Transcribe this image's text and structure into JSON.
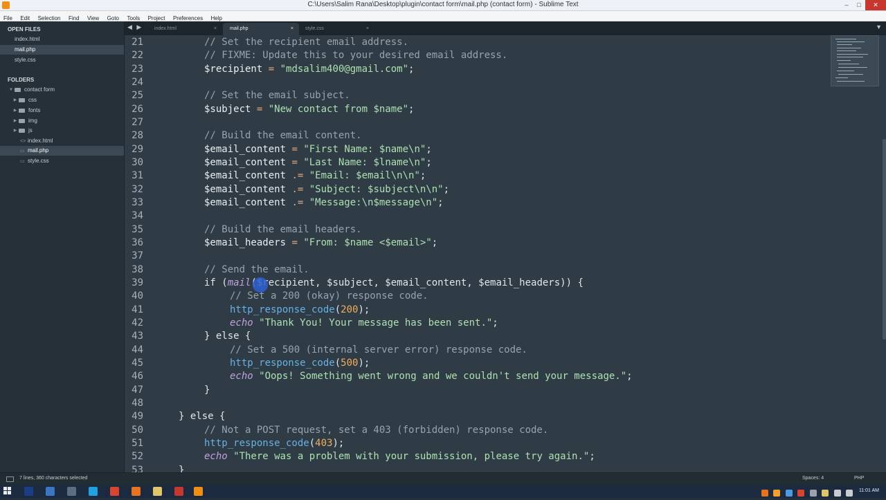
{
  "window": {
    "title": "C:\\Users\\Salim Rana\\Desktop\\plugin\\contact form\\mail.php (contact form) - Sublime Text",
    "controls": [
      "–",
      "□",
      "✕"
    ]
  },
  "menu": [
    "File",
    "Edit",
    "Selection",
    "Find",
    "View",
    "Goto",
    "Tools",
    "Project",
    "Preferences",
    "Help"
  ],
  "sidebar": {
    "open_files_header": "OPEN FILES",
    "open_files": [
      "index.html",
      "mail.php",
      "style.css"
    ],
    "folders_header": "FOLDERS",
    "root_folder": "contact form",
    "folders": [
      "css",
      "fonts",
      "img",
      "js"
    ],
    "files": [
      "index.html",
      "mail.php",
      "style.css"
    ]
  },
  "tabs": [
    {
      "label": "index.html",
      "close": "×"
    },
    {
      "label": "mail.php",
      "close": "×"
    },
    {
      "label": "style.css",
      "close": "×"
    }
  ],
  "tab_arrows": "◀ ▶",
  "tab_menu": "▼",
  "editor": {
    "line_numbers": [
      "21",
      "22",
      "23",
      "24",
      "25",
      "26",
      "27",
      "28",
      "29",
      "30",
      "31",
      "32",
      "33",
      "34",
      "35",
      "36",
      "37",
      "38",
      "39",
      "40",
      "41",
      "42",
      "43",
      "44",
      "45",
      "46",
      "47",
      "48",
      "49",
      "50",
      "51",
      "52",
      "53"
    ],
    "code": {
      "l21": "// Set the recipient email address.",
      "l22": "// FIXME: Update this to your desired email address.",
      "l23_var": "$recipient",
      "l23_op": " = ",
      "l23_str": "\"mdsalim400@gmail.com\"",
      "l23_end": ";",
      "l25": "// Set the email subject.",
      "l26_var": "$subject",
      "l26_op": " = ",
      "l26_str": "\"New contact from $name\"",
      "l26_end": ";",
      "l28": "// Build the email content.",
      "l29_var": "$email_content",
      "l29_op": " = ",
      "l29_str": "\"First Name: $name\\n\"",
      "l29_end": ";",
      "l30_var": "$email_content",
      "l30_op": " = ",
      "l30_str": "\"Last Name: $lname\\n\"",
      "l30_end": ";",
      "l31_var": "$email_content",
      "l31_op": " .= ",
      "l31_str": "\"Email: $email\\n\\n\"",
      "l31_end": ";",
      "l32_var": "$email_content",
      "l32_op": " .= ",
      "l32_str": "\"Subject: $subject\\n\\n\"",
      "l32_end": ";",
      "l33_var": "$email_content",
      "l33_op": " .= ",
      "l33_str": "\"Message:\\n$message\\n\"",
      "l33_end": ";",
      "l35": "// Build the email headers.",
      "l36_var": "$email_headers",
      "l36_op": " = ",
      "l36_str": "\"From: $name <$email>\"",
      "l36_end": ";",
      "l38": "// Send the email.",
      "l39_if": "if (",
      "l39_fn": "mail",
      "l39_rest": "($recipient, $subject, $email_content, $email_headers)) {",
      "l40": "// Set a 200 (okay) response code.",
      "l41_fn": "http_response_code",
      "l41_open": "(",
      "l41_num": "200",
      "l41_close": ");",
      "l42_kw": "echo",
      "l42_str": " \"Thank You! Your message has been sent.\"",
      "l42_end": ";",
      "l43": "} else {",
      "l44": "// Set a 500 (internal server error) response code.",
      "l45_fn": "http_response_code",
      "l45_open": "(",
      "l45_num": "500",
      "l45_close": ");",
      "l46_kw": "echo",
      "l46_str": " \"Oops! Something went wrong and we couldn't send your message.\"",
      "l46_end": ";",
      "l47": "}",
      "l49": "} else {",
      "l50": "// Not a POST request, set a 403 (forbidden) response code.",
      "l51_fn": "http_response_code",
      "l51_open": "(",
      "l51_num": "403",
      "l51_close": ");",
      "l52_kw": "echo",
      "l52_str": " \"There was a problem with your submission, please try again.\"",
      "l52_end": ";",
      "l53": "}"
    }
  },
  "status": {
    "selection": "7 lines, 360 characters selected",
    "spaces": "Spaces: 4",
    "syntax": "PHP"
  },
  "taskbar": {
    "clock": "11:01 AM"
  },
  "colors": {
    "editor_bg": "#2f3c46",
    "sidebar_bg": "#253039",
    "comment": "#97a4ad",
    "string": "#aee0b0",
    "function": "#66b1e6",
    "number": "#f2ae5a",
    "keyword": "#c3a0dc"
  }
}
